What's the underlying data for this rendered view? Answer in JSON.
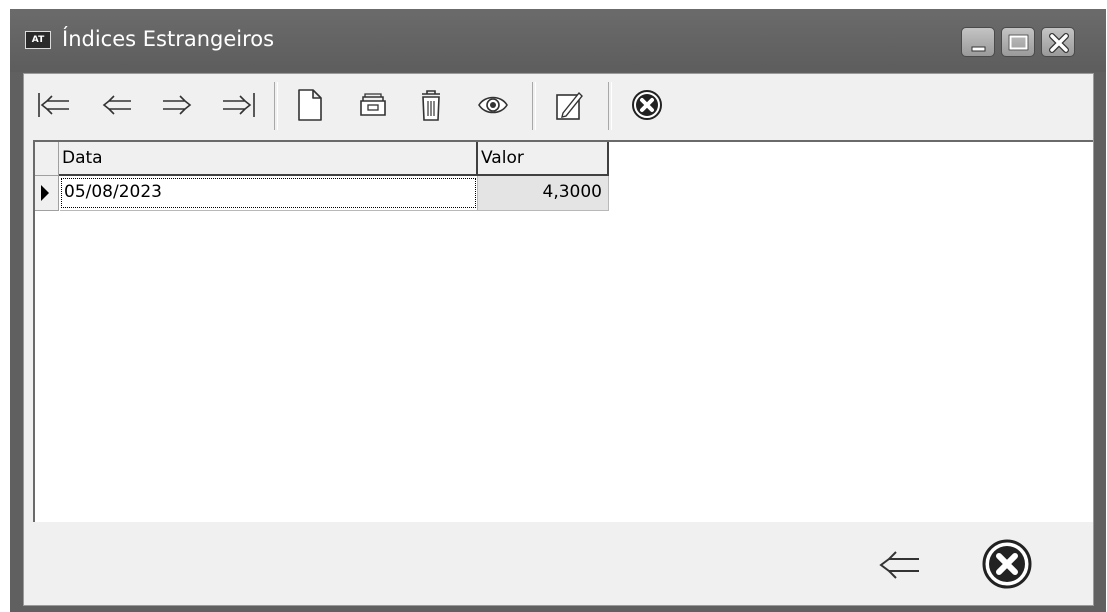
{
  "window": {
    "app_icon_text": "AT",
    "title": "Índices Estrangeiros"
  },
  "toolbar": {
    "buttons": [
      {
        "name": "first-record",
        "icon": "first-arrow-icon"
      },
      {
        "name": "previous-record",
        "icon": "left-arrow-icon"
      },
      {
        "name": "next-record",
        "icon": "right-arrow-icon"
      },
      {
        "name": "last-record",
        "icon": "last-arrow-icon"
      },
      {
        "name": "new-record",
        "icon": "new-document-icon"
      },
      {
        "name": "open-record",
        "icon": "folder-icon"
      },
      {
        "name": "delete-record",
        "icon": "trash-icon"
      },
      {
        "name": "view-record",
        "icon": "eye-icon"
      },
      {
        "name": "edit-record",
        "icon": "edit-icon"
      },
      {
        "name": "cancel",
        "icon": "cancel-icon"
      }
    ]
  },
  "grid": {
    "columns": [
      "Data",
      "Valor"
    ],
    "rows": [
      {
        "data": "05/08/2023",
        "valor": "4,3000"
      }
    ]
  },
  "colors": {
    "titlebar": "#606060",
    "panel": "#f0f0f0",
    "grid_background": "#ffffff",
    "selected_cell": "#e4e4e4"
  }
}
